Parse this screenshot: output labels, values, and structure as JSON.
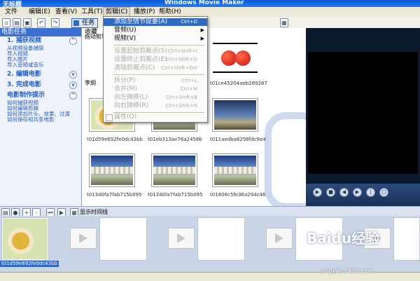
{
  "window": {
    "app_title": "无标题",
    "title": "Windows Movie Maker"
  },
  "menubar": {
    "items": [
      {
        "label": "文件"
      },
      {
        "label": "编辑(E)"
      },
      {
        "label": "查看(V)"
      },
      {
        "label": "工具(T)"
      },
      {
        "label": "剪辑(C)"
      },
      {
        "label": "播放(P)"
      },
      {
        "label": "帮助(H)"
      }
    ]
  },
  "toolbar": {
    "task_label": "任务"
  },
  "sidebar": {
    "header": "电影任务",
    "sections": [
      {
        "label": "1. 捕获视频",
        "links": [
          "从视频设备捕获",
          "导入视频",
          "导入图片",
          "导入音频或音乐"
        ]
      },
      {
        "label": "2. 编辑电影",
        "links": []
      },
      {
        "label": "3. 完成电影",
        "links": []
      },
      {
        "label": "电影制作提示",
        "links": [
          "如何捕获视频",
          "如何编辑剪辑",
          "如何添加片头、效果、过渡",
          "如何保存和共享电影"
        ]
      }
    ]
  },
  "collection": {
    "title": "收藏",
    "subtitle": "拖动剪辑",
    "left_label": "李炯"
  },
  "clips": [
    {
      "caption": "t01ce45204aeb289287"
    },
    {
      "caption": "t01d59e692fe0dc43bb"
    },
    {
      "caption": "t01eb313ae76a2458b"
    },
    {
      "caption": "t011aedba6298fdc9a4"
    },
    {
      "caption": "t01340fa7fab715b095"
    },
    {
      "caption": "t01340fa7fab715b095"
    },
    {
      "caption": "t01806c5fe36a294c46"
    }
  ],
  "dropdown": {
    "items": [
      {
        "label": "添加至情节提要(A)",
        "shortcut": "Ctrl+D",
        "state": "highlighted"
      },
      {
        "label": "音频(U)",
        "submenu": "▶",
        "state": "enabled"
      },
      {
        "label": "视频(V)",
        "submenu": "▶",
        "state": "enabled"
      },
      {
        "label": "设置起始剪裁点(S)",
        "shortcut": "Ctrl+Shift+I",
        "state": "disabled"
      },
      {
        "label": "设置终止剪裁点(E)",
        "shortcut": "Ctrl+Shift+O",
        "state": "disabled"
      },
      {
        "label": "清除剪裁点(C)",
        "shortcut": "Ctrl+Shift+Del",
        "state": "disabled"
      },
      {
        "label": "拆分(P)",
        "shortcut": "Ctrl+L",
        "state": "disabled"
      },
      {
        "label": "合并(M)",
        "shortcut": "Ctrl+M",
        "state": "disabled"
      },
      {
        "label": "向左微移(L)",
        "shortcut": "Ctrl+Shift+B",
        "state": "disabled"
      },
      {
        "label": "向右微移(R)",
        "shortcut": "Ctrl+Shift+N",
        "state": "disabled"
      },
      {
        "label": "属性(O)",
        "state": "disabled"
      }
    ]
  },
  "timeline": {
    "label": "显示时间线",
    "first_clip_caption": "t01d59e692fe0dc43bb"
  },
  "watermark": {
    "text": "Baidu经验",
    "url": "jingyan.baidu.com"
  }
}
